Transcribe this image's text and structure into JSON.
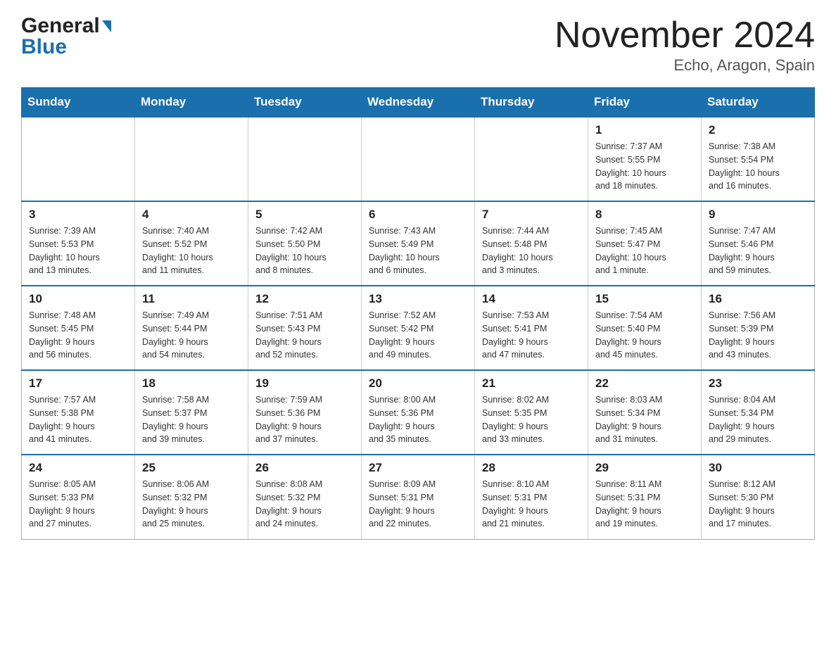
{
  "header": {
    "logo_general": "General",
    "logo_blue": "Blue",
    "month_title": "November 2024",
    "location": "Echo, Aragon, Spain"
  },
  "weekdays": [
    "Sunday",
    "Monday",
    "Tuesday",
    "Wednesday",
    "Thursday",
    "Friday",
    "Saturday"
  ],
  "weeks": [
    [
      {
        "day": "",
        "info": ""
      },
      {
        "day": "",
        "info": ""
      },
      {
        "day": "",
        "info": ""
      },
      {
        "day": "",
        "info": ""
      },
      {
        "day": "",
        "info": ""
      },
      {
        "day": "1",
        "info": "Sunrise: 7:37 AM\nSunset: 5:55 PM\nDaylight: 10 hours\nand 18 minutes."
      },
      {
        "day": "2",
        "info": "Sunrise: 7:38 AM\nSunset: 5:54 PM\nDaylight: 10 hours\nand 16 minutes."
      }
    ],
    [
      {
        "day": "3",
        "info": "Sunrise: 7:39 AM\nSunset: 5:53 PM\nDaylight: 10 hours\nand 13 minutes."
      },
      {
        "day": "4",
        "info": "Sunrise: 7:40 AM\nSunset: 5:52 PM\nDaylight: 10 hours\nand 11 minutes."
      },
      {
        "day": "5",
        "info": "Sunrise: 7:42 AM\nSunset: 5:50 PM\nDaylight: 10 hours\nand 8 minutes."
      },
      {
        "day": "6",
        "info": "Sunrise: 7:43 AM\nSunset: 5:49 PM\nDaylight: 10 hours\nand 6 minutes."
      },
      {
        "day": "7",
        "info": "Sunrise: 7:44 AM\nSunset: 5:48 PM\nDaylight: 10 hours\nand 3 minutes."
      },
      {
        "day": "8",
        "info": "Sunrise: 7:45 AM\nSunset: 5:47 PM\nDaylight: 10 hours\nand 1 minute."
      },
      {
        "day": "9",
        "info": "Sunrise: 7:47 AM\nSunset: 5:46 PM\nDaylight: 9 hours\nand 59 minutes."
      }
    ],
    [
      {
        "day": "10",
        "info": "Sunrise: 7:48 AM\nSunset: 5:45 PM\nDaylight: 9 hours\nand 56 minutes."
      },
      {
        "day": "11",
        "info": "Sunrise: 7:49 AM\nSunset: 5:44 PM\nDaylight: 9 hours\nand 54 minutes."
      },
      {
        "day": "12",
        "info": "Sunrise: 7:51 AM\nSunset: 5:43 PM\nDaylight: 9 hours\nand 52 minutes."
      },
      {
        "day": "13",
        "info": "Sunrise: 7:52 AM\nSunset: 5:42 PM\nDaylight: 9 hours\nand 49 minutes."
      },
      {
        "day": "14",
        "info": "Sunrise: 7:53 AM\nSunset: 5:41 PM\nDaylight: 9 hours\nand 47 minutes."
      },
      {
        "day": "15",
        "info": "Sunrise: 7:54 AM\nSunset: 5:40 PM\nDaylight: 9 hours\nand 45 minutes."
      },
      {
        "day": "16",
        "info": "Sunrise: 7:56 AM\nSunset: 5:39 PM\nDaylight: 9 hours\nand 43 minutes."
      }
    ],
    [
      {
        "day": "17",
        "info": "Sunrise: 7:57 AM\nSunset: 5:38 PM\nDaylight: 9 hours\nand 41 minutes."
      },
      {
        "day": "18",
        "info": "Sunrise: 7:58 AM\nSunset: 5:37 PM\nDaylight: 9 hours\nand 39 minutes."
      },
      {
        "day": "19",
        "info": "Sunrise: 7:59 AM\nSunset: 5:36 PM\nDaylight: 9 hours\nand 37 minutes."
      },
      {
        "day": "20",
        "info": "Sunrise: 8:00 AM\nSunset: 5:36 PM\nDaylight: 9 hours\nand 35 minutes."
      },
      {
        "day": "21",
        "info": "Sunrise: 8:02 AM\nSunset: 5:35 PM\nDaylight: 9 hours\nand 33 minutes."
      },
      {
        "day": "22",
        "info": "Sunrise: 8:03 AM\nSunset: 5:34 PM\nDaylight: 9 hours\nand 31 minutes."
      },
      {
        "day": "23",
        "info": "Sunrise: 8:04 AM\nSunset: 5:34 PM\nDaylight: 9 hours\nand 29 minutes."
      }
    ],
    [
      {
        "day": "24",
        "info": "Sunrise: 8:05 AM\nSunset: 5:33 PM\nDaylight: 9 hours\nand 27 minutes."
      },
      {
        "day": "25",
        "info": "Sunrise: 8:06 AM\nSunset: 5:32 PM\nDaylight: 9 hours\nand 25 minutes."
      },
      {
        "day": "26",
        "info": "Sunrise: 8:08 AM\nSunset: 5:32 PM\nDaylight: 9 hours\nand 24 minutes."
      },
      {
        "day": "27",
        "info": "Sunrise: 8:09 AM\nSunset: 5:31 PM\nDaylight: 9 hours\nand 22 minutes."
      },
      {
        "day": "28",
        "info": "Sunrise: 8:10 AM\nSunset: 5:31 PM\nDaylight: 9 hours\nand 21 minutes."
      },
      {
        "day": "29",
        "info": "Sunrise: 8:11 AM\nSunset: 5:31 PM\nDaylight: 9 hours\nand 19 minutes."
      },
      {
        "day": "30",
        "info": "Sunrise: 8:12 AM\nSunset: 5:30 PM\nDaylight: 9 hours\nand 17 minutes."
      }
    ]
  ]
}
